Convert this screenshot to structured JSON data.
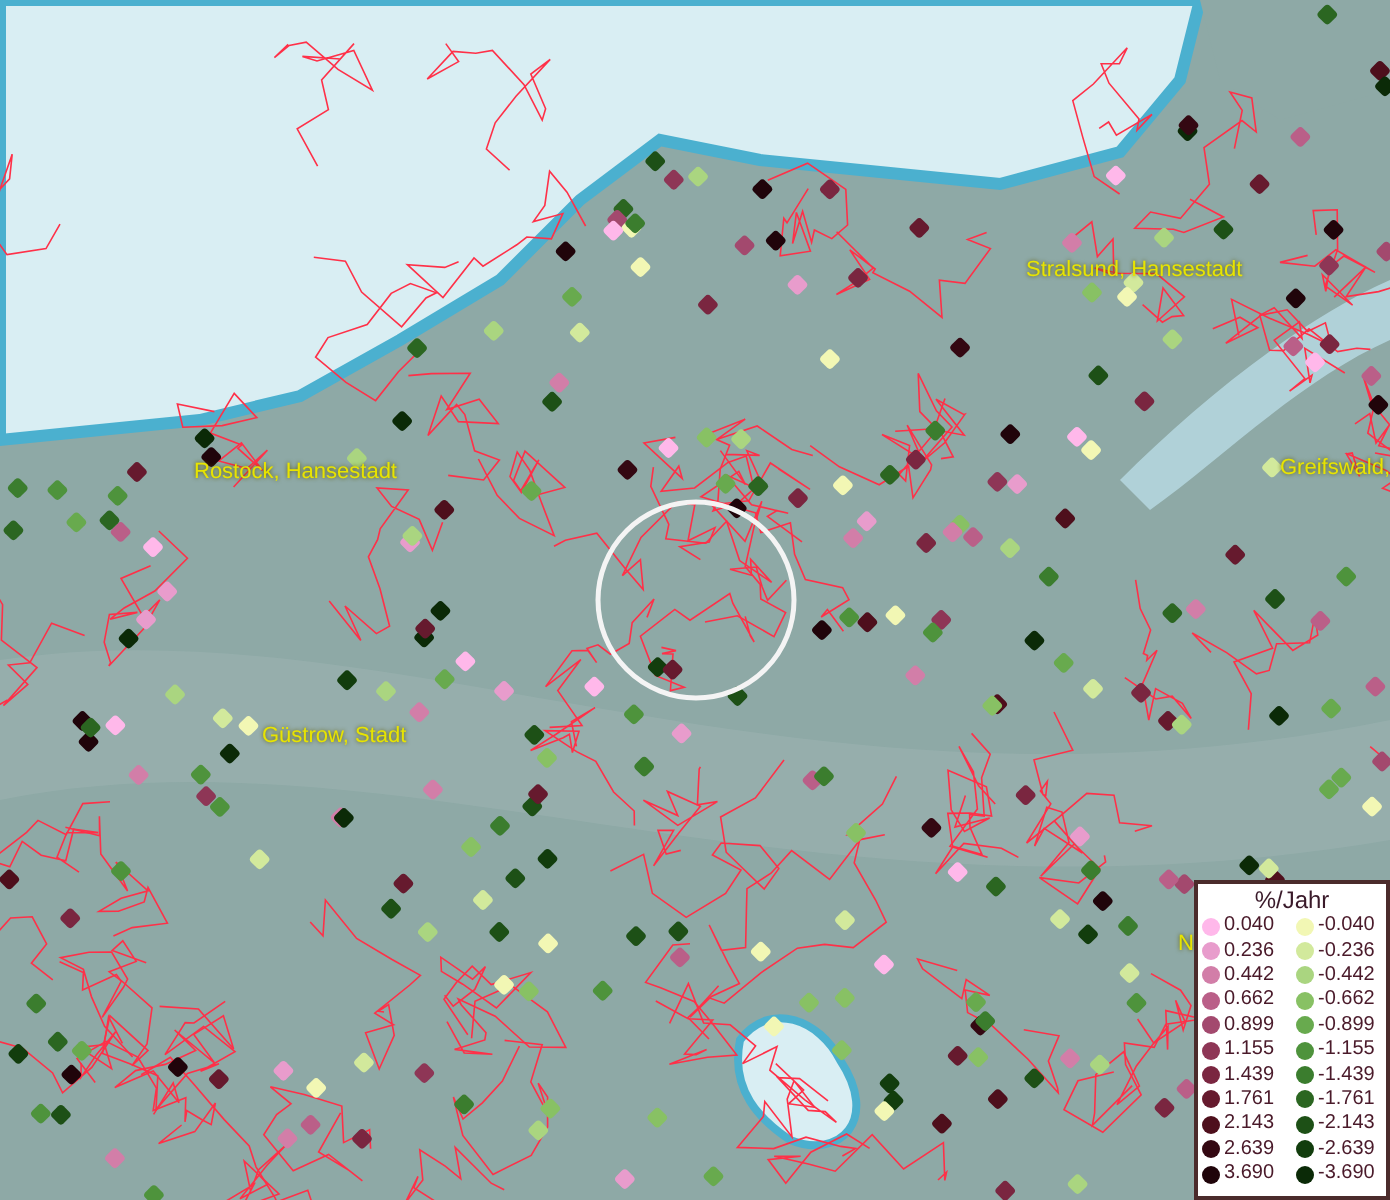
{
  "map": {
    "labels": [
      {
        "text": "Stralsund, Hansestadt"
      },
      {
        "text": "Rostock, Hansestadt"
      },
      {
        "text": "Greifswald,"
      },
      {
        "text": "Güstrow, Stadt"
      },
      {
        "text": "N"
      }
    ]
  },
  "legend": {
    "title": "%/Jahr",
    "columns": [
      [
        {
          "label": "0.040",
          "color": "#ffb8ea"
        },
        {
          "label": "0.236",
          "color": "#e89ccc"
        },
        {
          "label": "0.442",
          "color": "#d27ea8"
        },
        {
          "label": "0.662",
          "color": "#ba5f88"
        },
        {
          "label": "0.899",
          "color": "#a3496e"
        },
        {
          "label": "1.155",
          "color": "#8e3656"
        },
        {
          "label": "1.439",
          "color": "#7a2640"
        },
        {
          "label": "1.761",
          "color": "#661a2e"
        },
        {
          "label": "2.143",
          "color": "#4e0f1c"
        },
        {
          "label": "2.639",
          "color": "#340812"
        },
        {
          "label": "3.690",
          "color": "#20040a"
        }
      ],
      [
        {
          "label": "-0.040",
          "color": "#f2f7b4"
        },
        {
          "label": "-0.236",
          "color": "#d2e99c"
        },
        {
          "label": "-0.442",
          "color": "#aad580"
        },
        {
          "label": "-0.662",
          "color": "#88c164"
        },
        {
          "label": "-0.899",
          "color": "#68aa4e"
        },
        {
          "label": "-1.155",
          "color": "#4e933c"
        },
        {
          "label": "-1.439",
          "color": "#3b7d2e"
        },
        {
          "label": "-1.761",
          "color": "#2b6621"
        },
        {
          "label": "-2.143",
          "color": "#1d5016"
        },
        {
          "label": "-2.639",
          "color": "#123d0d"
        },
        {
          "label": "-3.690",
          "color": "#0b2a07"
        }
      ]
    ]
  }
}
